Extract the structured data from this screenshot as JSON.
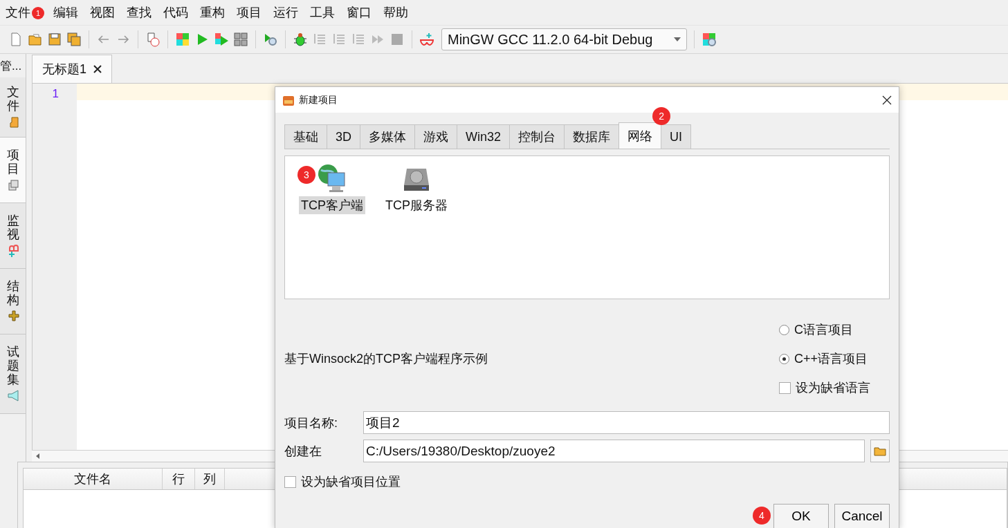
{
  "menu": [
    {
      "label": "文件",
      "badge": "1"
    },
    {
      "label": "编辑"
    },
    {
      "label": "视图"
    },
    {
      "label": "查找"
    },
    {
      "label": "代码"
    },
    {
      "label": "重构"
    },
    {
      "label": "项目"
    },
    {
      "label": "运行"
    },
    {
      "label": "工具"
    },
    {
      "label": "窗口"
    },
    {
      "label": "帮助"
    }
  ],
  "toolbar": {
    "compiler": "MinGW GCC 11.2.0 64-bit Debug"
  },
  "side_panel": {
    "header": "管...",
    "tabs": [
      {
        "label": "文件",
        "selected": false
      },
      {
        "label": "项目",
        "selected": true
      },
      {
        "label": "监视",
        "selected": false
      },
      {
        "label": "结构",
        "selected": false
      },
      {
        "label": "试题集",
        "selected": false
      }
    ]
  },
  "editor": {
    "tabs": [
      {
        "label": "无标题1",
        "selected": true
      }
    ],
    "line_numbers": [
      "1"
    ]
  },
  "bottom_panel": {
    "columns": [
      "文件名",
      "行",
      "列"
    ]
  },
  "dialog": {
    "title": "新建项目",
    "tabs": [
      {
        "label": "基础",
        "selected": false
      },
      {
        "label": "3D",
        "selected": false
      },
      {
        "label": "多媒体",
        "selected": false
      },
      {
        "label": "游戏",
        "selected": false
      },
      {
        "label": "Win32",
        "selected": false
      },
      {
        "label": "控制台",
        "selected": false
      },
      {
        "label": "数据库",
        "selected": false
      },
      {
        "label": "网络",
        "selected": true,
        "badge": "2"
      },
      {
        "label": "UI",
        "selected": false
      }
    ],
    "templates": [
      {
        "label": "TCP客户端",
        "kind": "globe",
        "selected": true,
        "badge": "3"
      },
      {
        "label": "TCP服务器",
        "kind": "drive",
        "selected": false
      }
    ],
    "description": "基于Winsock2的TCP客户端程序示例",
    "languages": [
      {
        "label": "C语言项目",
        "selected": false
      },
      {
        "label": "C++语言项目",
        "selected": true
      }
    ],
    "default_language": {
      "label": "设为缺省语言",
      "checked": false
    },
    "name": {
      "label": "项目名称:",
      "value": "项目2"
    },
    "location": {
      "label": "创建在",
      "value": "C:/Users/19380/Desktop/zuoye2"
    },
    "default_location": {
      "label": "设为缺省项目位置",
      "checked": false
    },
    "buttons": [
      {
        "label": "OK",
        "badge": "4"
      },
      {
        "label": "Cancel"
      }
    ]
  }
}
